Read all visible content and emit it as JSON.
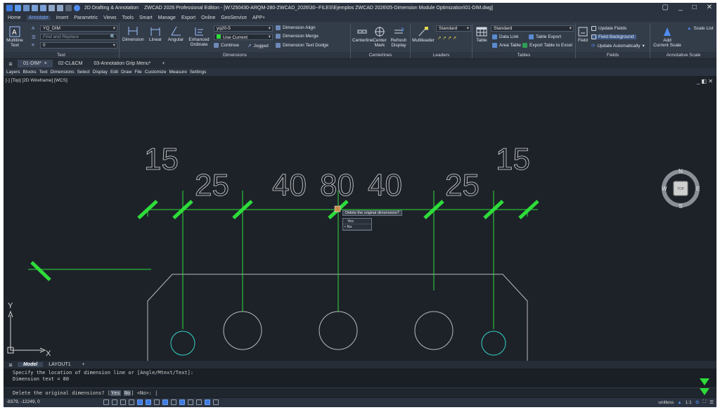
{
  "window": {
    "workspace": "2D Drafting & Annotation",
    "title": "ZWCAD 2026 Professional Edition - [W:\\250430-ARQM-280-ZWCAD_2026\\30--FILES\\Ejemplos ZWCAD 2026\\05-Dimension Module Optimization\\01-DIM.dwg]"
  },
  "menu_tabs": [
    "Home",
    "Annotate",
    "Insert",
    "Parametric",
    "Views",
    "Tools",
    "Smart",
    "Manage",
    "Export",
    "Online",
    "GeoService",
    "APP+"
  ],
  "ribbon": {
    "text": {
      "multiline": "Multiline",
      "multiline2": "Text",
      "style": "YQ_DIM",
      "find": "Find and Replace",
      "height": "0",
      "label": "Text"
    },
    "dimensions": {
      "dimension": "Dimension",
      "linear": "Linear",
      "angular": "Angular",
      "enhanced": "Enhanced",
      "ordinate": "Ordinate",
      "style": "yq20-5",
      "layer": "Use Current",
      "continue": "Continue",
      "jogged": "Jogged",
      "align": "Dimension Align",
      "merge": "Dimension Merge",
      "dodge": "Dimension Text Dodge",
      "label": "Dimensions"
    },
    "centerlines": {
      "centerline": "Centerline",
      "center": "Center",
      "mark": "Mark",
      "refresh": "Refresh",
      "display": "Display",
      "label": "Centerlines"
    },
    "leaders": {
      "multileader": "Multileader",
      "style": "Standard",
      "label": "Leaders"
    },
    "tables": {
      "table": "Table",
      "style": "Standard",
      "datalink": "Data Link",
      "tableexport": "Table Export",
      "areatable": "Area Table",
      "excel": "Export Table to Excel",
      "label": "Tables"
    },
    "fields": {
      "field": "Field",
      "update": "Update Fields",
      "background": "Field Background",
      "auto": "Update Automatically",
      "label": "Fields"
    },
    "annoscale": {
      "add": "Add",
      "current": "Current Scale",
      "list": "Scale List",
      "label": "Annotative Scale"
    }
  },
  "file_tabs": [
    "01-DIM*",
    "02-CL&CM",
    "03-Annotation Grip Menu*"
  ],
  "menubar": [
    "Layers",
    "Blocks",
    "Text",
    "Dimensions",
    "Select",
    "Display",
    "Edit",
    "Draw",
    "File",
    "Customize",
    "Measure",
    "Settings"
  ],
  "canvas": {
    "view_label": "[-] [Top] [2D Wireframe] [WCS]",
    "dims": [
      "15",
      "25",
      "40",
      "80",
      "40",
      "25",
      "15"
    ],
    "popup_question": "Delete the original dimensions?",
    "popup_options": [
      "Yes",
      "No"
    ],
    "popup_selected": "No",
    "viewcube": {
      "n": "N",
      "s": "S",
      "e": "E",
      "w": "W",
      "top": "TOP"
    },
    "ucs_x": "X",
    "ucs_y": "Y"
  },
  "layout_tabs": [
    "Model",
    "LAYOUT1"
  ],
  "command": {
    "line1": "Specify the location of dimension line or [Angle/Mtext/Text]:",
    "line2": "Dimension text = 80",
    "prompt_pre": "Delete the original dimensions? [",
    "opt_yes": "Yes",
    "opt_no": "No",
    "prompt_post": "] <No>: "
  },
  "status": {
    "coords": "-8379, -12249, 0",
    "units": "unitless",
    "scale": "1:1"
  },
  "colors": {
    "dim_green": "#2edc3a",
    "cyan": "#35d4c4",
    "geom": "#b8b8b8"
  }
}
